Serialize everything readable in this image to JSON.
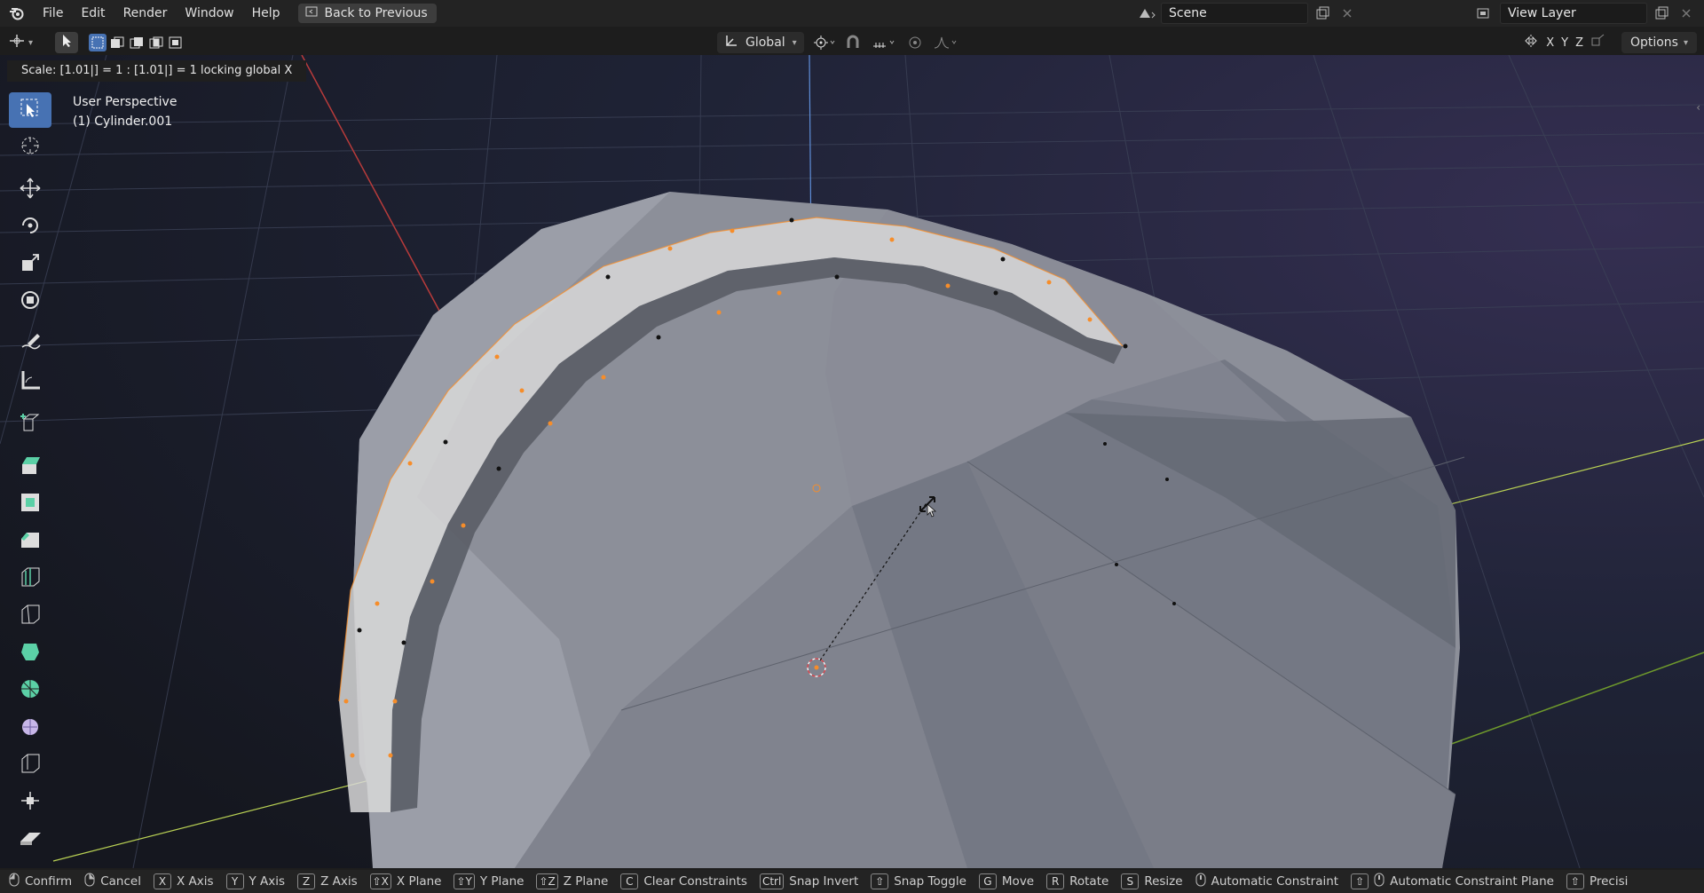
{
  "menu": [
    "File",
    "Edit",
    "Render",
    "Window",
    "Help"
  ],
  "back_button": "Back to Previous",
  "scene": {
    "name": "Scene"
  },
  "view_layer": {
    "name": "View Layer"
  },
  "orientation": "Global",
  "options_label": "Options",
  "axes": [
    "X",
    "Y",
    "Z"
  ],
  "header_info": "Scale: [1.01|] = 1  : [1.01|] = 1  locking global X",
  "viewport": {
    "perspective": "User Perspective",
    "object": "(1) Cylinder.001"
  },
  "status": [
    {
      "key": "",
      "label": "Confirm"
    },
    {
      "key": "",
      "label": "Cancel"
    },
    {
      "key": "X",
      "label": "X Axis"
    },
    {
      "key": "Y",
      "label": "Y Axis"
    },
    {
      "key": "Z",
      "label": "Z Axis"
    },
    {
      "key": "⇧X",
      "label": "X Plane"
    },
    {
      "key": "⇧Y",
      "label": "Y Plane"
    },
    {
      "key": "⇧Z",
      "label": "Z Plane"
    },
    {
      "key": "C",
      "label": "Clear Constraints"
    },
    {
      "key": "Ctrl",
      "label": "Snap Invert"
    },
    {
      "key": "⇧",
      "label": "Snap Toggle"
    },
    {
      "key": "G",
      "label": "Move"
    },
    {
      "key": "R",
      "label": "Rotate"
    },
    {
      "key": "S",
      "label": "Resize"
    },
    {
      "key": "",
      "label": "Automatic Constraint"
    },
    {
      "key": "⇧",
      "label": "Automatic Constraint Plane"
    },
    {
      "key": "⇧",
      "label": "Precisi"
    }
  ],
  "colors": {
    "accent": "#4772b3",
    "selected": "#f68d2a",
    "viewport_bg": "#1e2233"
  }
}
